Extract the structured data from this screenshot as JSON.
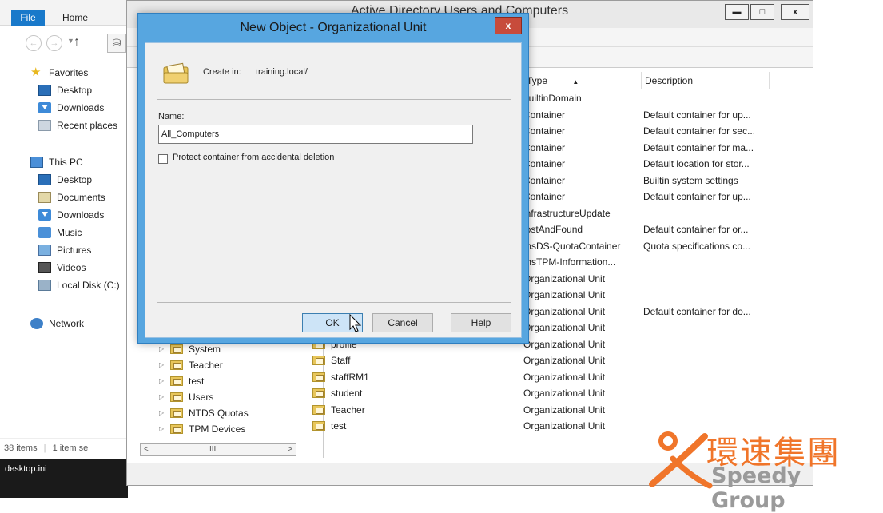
{
  "explorer": {
    "tabs": {
      "file": "File",
      "home": "Home"
    },
    "nav_items": [
      {
        "label": "Favorites",
        "icon": "star-icon",
        "level": 0
      },
      {
        "label": "Desktop",
        "icon": "desktop-icon",
        "level": 1
      },
      {
        "label": "Downloads",
        "icon": "downloads-icon",
        "level": 1
      },
      {
        "label": "Recent places",
        "icon": "recent-places-icon",
        "level": 1
      },
      {
        "label": "This PC",
        "icon": "computer-icon",
        "level": 0
      },
      {
        "label": "Desktop",
        "icon": "desktop-icon",
        "level": 1
      },
      {
        "label": "Documents",
        "icon": "documents-icon",
        "level": 1
      },
      {
        "label": "Downloads",
        "icon": "downloads-icon",
        "level": 1
      },
      {
        "label": "Music",
        "icon": "music-icon",
        "level": 1
      },
      {
        "label": "Pictures",
        "icon": "pictures-icon",
        "level": 1
      },
      {
        "label": "Videos",
        "icon": "videos-icon",
        "level": 1
      },
      {
        "label": "Local Disk (C:)",
        "icon": "local-disk-icon",
        "level": 1
      },
      {
        "label": "Network",
        "icon": "network-icon",
        "level": 0
      }
    ],
    "status": {
      "items_count": "38 items",
      "selected": "1 item se"
    },
    "bottom_file": "desktop.ini"
  },
  "aduc": {
    "title": "Active Directory Users and Computers",
    "tree_items": [
      "System",
      "Teacher",
      "test",
      "Users",
      "NTDS Quotas",
      "TPM Devices"
    ],
    "scroll_mid": "III",
    "columns": {
      "type": "Type",
      "description": "Description"
    },
    "rows": [
      {
        "name": "",
        "type": "builtinDomain",
        "description": ""
      },
      {
        "name": "",
        "type": "Container",
        "description": "Default container for up..."
      },
      {
        "name": "",
        "type": "Container",
        "description": "Default container for sec..."
      },
      {
        "name": "",
        "type": "Container",
        "description": "Default container for ma..."
      },
      {
        "name": "",
        "type": "Container",
        "description": "Default location for stor..."
      },
      {
        "name": "",
        "type": "Container",
        "description": "Builtin system settings"
      },
      {
        "name": "",
        "type": "Container",
        "description": "Default container for up..."
      },
      {
        "name": "",
        "type": "infrastructureUpdate",
        "description": ""
      },
      {
        "name": "",
        "type": "lostAndFound",
        "description": "Default container for or..."
      },
      {
        "name": "",
        "type": "msDS-QuotaContainer",
        "description": "Quota specifications co..."
      },
      {
        "name": "",
        "type": "msTPM-Information...",
        "description": ""
      },
      {
        "name": "",
        "type": "Organizational Unit",
        "description": ""
      },
      {
        "name": "",
        "type": "Organizational Unit",
        "description": ""
      },
      {
        "name": "",
        "type": "Organizational Unit",
        "description": "Default container for do..."
      },
      {
        "name": "",
        "type": "Organizational Unit",
        "description": ""
      },
      {
        "name": "profile",
        "type": "Organizational Unit",
        "description": ""
      },
      {
        "name": "Staff",
        "type": "Organizational Unit",
        "description": ""
      },
      {
        "name": "staffRM1",
        "type": "Organizational Unit",
        "description": ""
      },
      {
        "name": "student",
        "type": "Organizational Unit",
        "description": ""
      },
      {
        "name": "Teacher",
        "type": "Organizational Unit",
        "description": ""
      },
      {
        "name": "test",
        "type": "Organizational Unit",
        "description": ""
      }
    ]
  },
  "dialog": {
    "title": "New Object - Organizational Unit",
    "create_in_label": "Create in:",
    "create_in_value": "training.local/",
    "name_label": "Name:",
    "name_value": "All_Computers",
    "protect_label": "Protect container from accidental deletion",
    "protect_checked": false,
    "ok": "OK",
    "cancel": "Cancel",
    "help": "Help",
    "close": "x"
  },
  "logo": {
    "chinese": "環速集團",
    "english": "Speedy Group",
    "color": "#f0752a"
  },
  "colors": {
    "dialog_frame": "#57a6e0",
    "file_tab": "#1979ca",
    "close_button": "#c74b3b"
  }
}
